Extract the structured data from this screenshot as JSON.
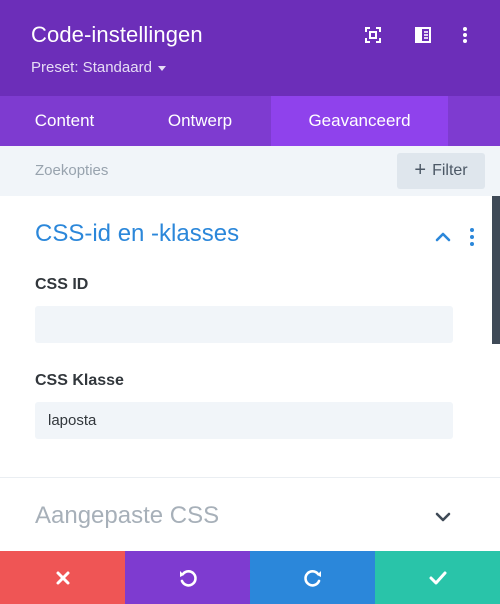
{
  "header": {
    "title": "Code-instellingen",
    "preset_label": "Preset: Standaard",
    "icons": [
      "fullscreen-icon",
      "sidebar-layout-icon",
      "more-vertical-icon"
    ]
  },
  "tabs": [
    {
      "label": "Content",
      "active": false
    },
    {
      "label": "Ontwerp",
      "active": false
    },
    {
      "label": "Geavanceerd",
      "active": true
    }
  ],
  "search": {
    "placeholder": "Zoekopties",
    "filter_label": "Filter"
  },
  "section_css_ids": {
    "title": "CSS-id en -klasses",
    "expanded": true,
    "fields": [
      {
        "label": "CSS ID",
        "value": ""
      },
      {
        "label": "CSS Klasse",
        "value": "laposta"
      }
    ]
  },
  "section_custom_css": {
    "title": "Aangepaste CSS",
    "expanded": false
  },
  "footer": {
    "buttons": [
      {
        "name": "cancel",
        "icon": "close-icon",
        "color": "#ef5555"
      },
      {
        "name": "undo",
        "icon": "undo-icon",
        "color": "#7e3bd0"
      },
      {
        "name": "redo",
        "icon": "redo-icon",
        "color": "#2b87da"
      },
      {
        "name": "save",
        "icon": "check-icon",
        "color": "#29c4a9"
      }
    ]
  },
  "colors": {
    "header_bg": "#6c2eb9",
    "tabs_bg": "#7e3bd0",
    "active_tab_bg": "#8f42ec",
    "accent_blue": "#2b87da"
  }
}
